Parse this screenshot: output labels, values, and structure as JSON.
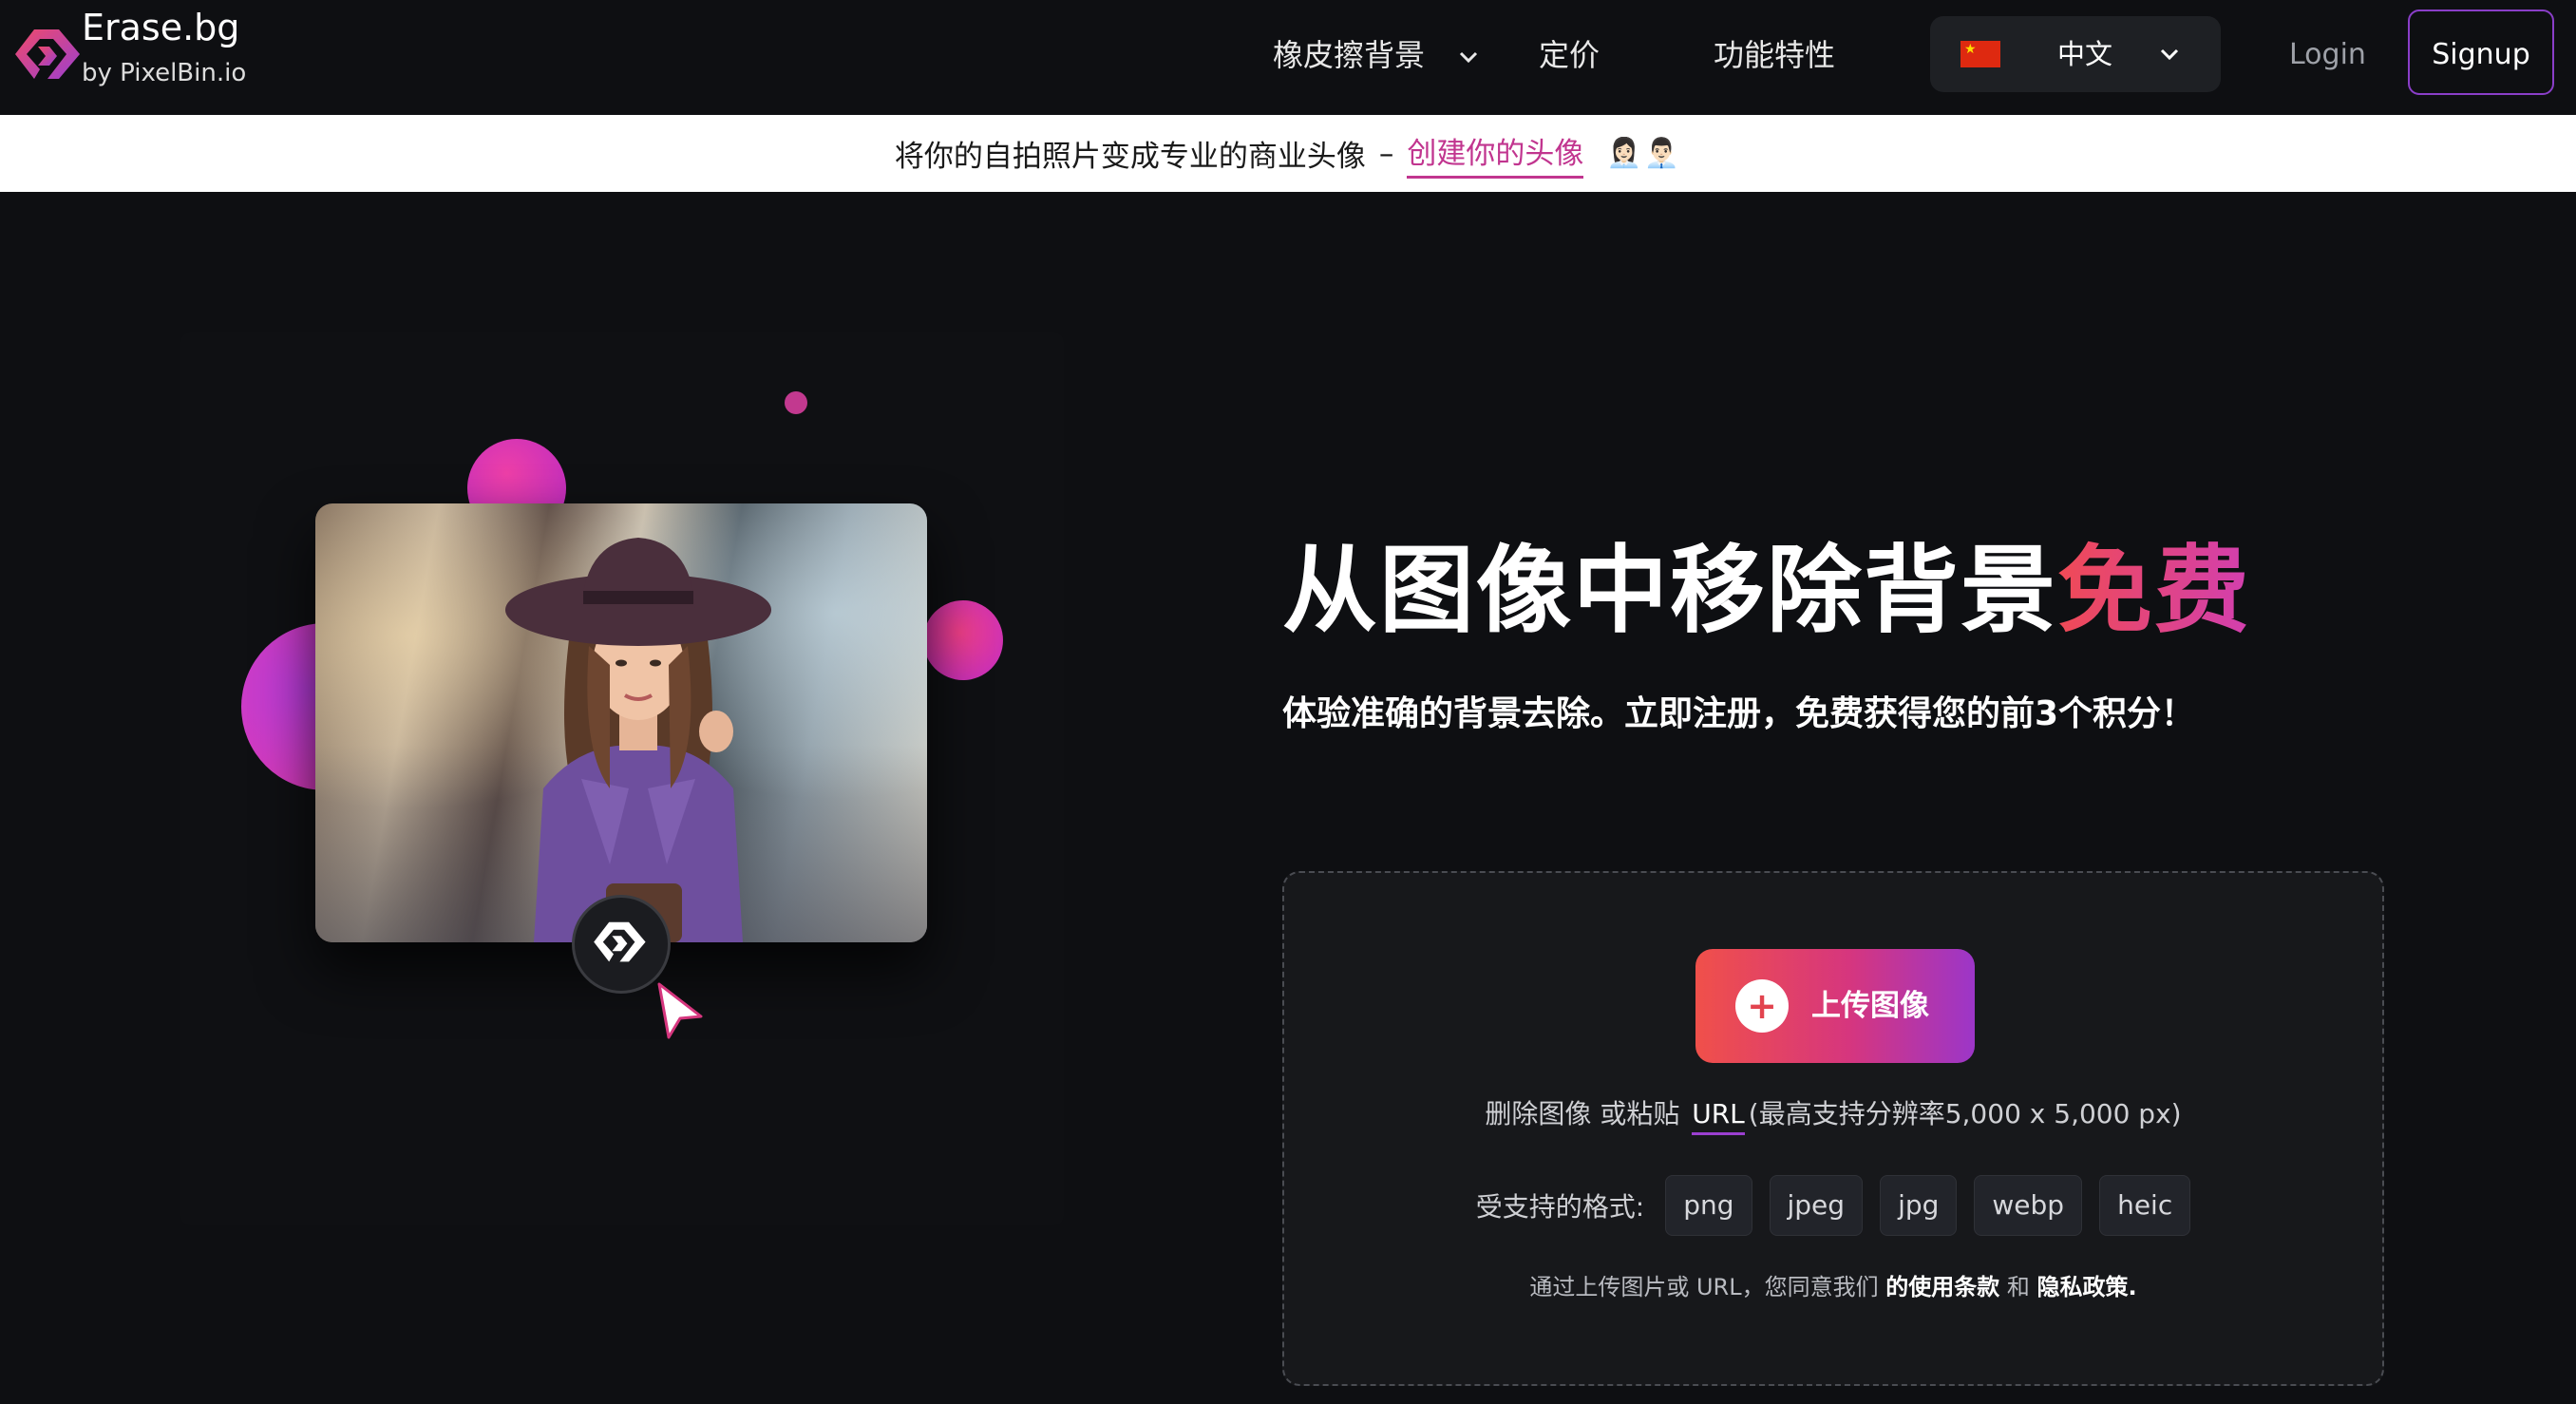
{
  "brand": {
    "name": "Erase.bg",
    "by": "by PixelBin.io",
    "accent": "#c1358f"
  },
  "nav": {
    "items": [
      {
        "label": "橡皮擦背景",
        "has_dropdown": true
      },
      {
        "label": "定价"
      },
      {
        "label": "功能特性"
      }
    ],
    "language": {
      "label": "中文",
      "flag": "china-flag-icon"
    },
    "login": "Login",
    "signup": "Signup"
  },
  "promo": {
    "text": "将你的自拍照片变成专业的商业头像",
    "dash": "–",
    "cta": "创建你的头像",
    "emoji": "👩🏻‍💼👨🏻‍💼"
  },
  "hero": {
    "headline_main": "从图像中移除背景",
    "headline_accent": "免费",
    "subhead": "体验准确的背景去除。立即注册，免费获得您的前3个积分！",
    "upload_label": "上传图像",
    "drop_prefix": "删除图像 或粘贴",
    "drop_url": "URL",
    "drop_suffix": "(最高支持分辨率5,000 x 5,000 px)",
    "formats_label": "受支持的格式:",
    "formats": [
      "png",
      "jpeg",
      "jpg",
      "webp",
      "heic"
    ],
    "terms_prefix": "通过上传图片或 URL，您同意我们",
    "terms_link": "的使用条款",
    "terms_and": "和",
    "privacy_link": "隐私政策."
  }
}
